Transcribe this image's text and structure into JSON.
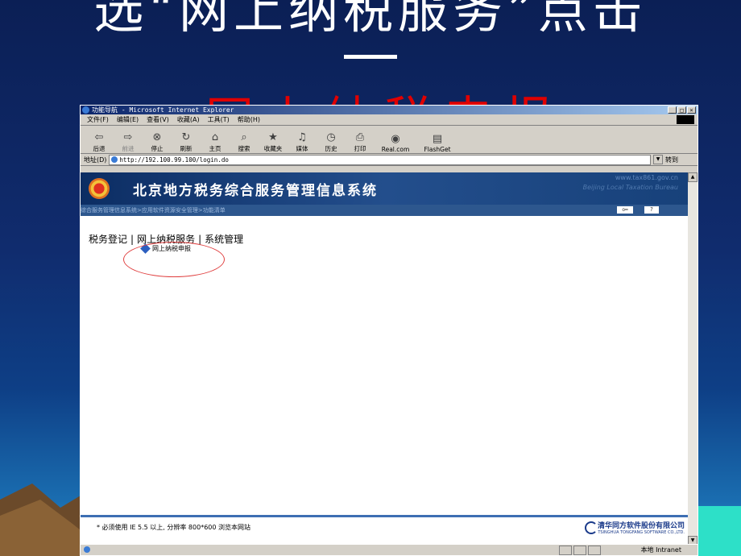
{
  "slide": {
    "title": "选“网上纳税服务”点击",
    "dash": "—",
    "red_text": "网上纳税申报"
  },
  "window": {
    "title": "功能导航 - Microsoft Internet Explorer",
    "controls": [
      "_",
      "□",
      "×"
    ],
    "menu": [
      "文件(F)",
      "编辑(E)",
      "查看(V)",
      "收藏(A)",
      "工具(T)",
      "帮助(H)"
    ],
    "toolbar": [
      {
        "label": "后退",
        "icon": "back-icon",
        "glyph": "⇦"
      },
      {
        "label": "前进",
        "icon": "forward-icon",
        "glyph": "⇨"
      },
      {
        "label": "停止",
        "icon": "stop-icon",
        "glyph": "⊗"
      },
      {
        "label": "刷新",
        "icon": "refresh-icon",
        "glyph": "↻"
      },
      {
        "label": "主页",
        "icon": "home-icon",
        "glyph": "⌂"
      },
      {
        "label": "搜索",
        "icon": "search-icon",
        "glyph": "⌕"
      },
      {
        "label": "收藏夹",
        "icon": "favorites-icon",
        "glyph": "★"
      },
      {
        "label": "媒体",
        "icon": "media-icon",
        "glyph": "♫"
      },
      {
        "label": "历史",
        "icon": "history-icon",
        "glyph": "◷"
      },
      {
        "label": "打印",
        "icon": "print-icon",
        "glyph": "⎙"
      },
      {
        "label": "Real.com",
        "icon": "real-icon",
        "glyph": "◉"
      },
      {
        "label": "FlashGet",
        "icon": "flashget-icon",
        "glyph": "▤"
      }
    ],
    "address_label": "地址(D)",
    "address_value": "http://192.100.99.100/login.do",
    "go_label": "转到",
    "status_zone": "本地 Intranet"
  },
  "page": {
    "system_title": "北京地方税务综合服务管理信息系统",
    "english_title": "Beijing Local Taxation Bureau",
    "url_logo": "www.tax861.gov.cn",
    "breadcrumb": "综合服务管理信息系统>应用软件资源安全管理>功能清单",
    "nav": [
      "税务登记",
      "网上纳税服务",
      "系统管理"
    ],
    "nav_sep": "|",
    "sub_item": "网上纳税申报",
    "help_icon": "?",
    "notice": "* 必须使用 IE 5.5 以上, 分辨率 800*600 浏览本网站",
    "company_cn": "清华同方软件股份有限公司",
    "company_en": "TSINGHUA TONGFANG SOFTWARE CO.,LTD."
  }
}
